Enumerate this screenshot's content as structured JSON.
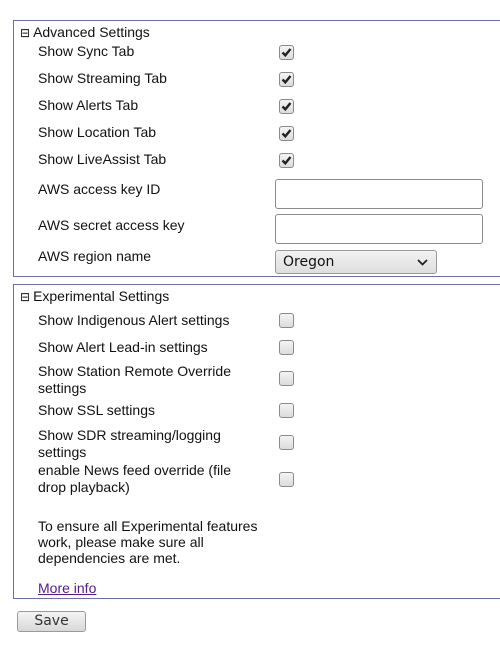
{
  "advanced": {
    "title": "Advanced Settings",
    "toggle_icon": "collapse-box-minus",
    "checkboxes": [
      {
        "label": "Show Sync Tab",
        "checked": true
      },
      {
        "label": "Show Streaming Tab",
        "checked": true
      },
      {
        "label": "Show Alerts Tab",
        "checked": true
      },
      {
        "label": "Show Location Tab",
        "checked": true
      },
      {
        "label": "Show LiveAssist Tab",
        "checked": true
      }
    ],
    "aws_access_key": {
      "label": "AWS access key ID",
      "value": ""
    },
    "aws_secret_key": {
      "label": "AWS secret access key",
      "value": ""
    },
    "aws_region": {
      "label": "AWS region name",
      "selected": "Oregon"
    }
  },
  "experimental": {
    "title": "Experimental Settings",
    "toggle_icon": "collapse-box-minus",
    "checkboxes": [
      {
        "label": "Show Indigenous Alert settings",
        "checked": false
      },
      {
        "label": "Show Alert Lead-in settings",
        "checked": false
      },
      {
        "label": "Show Station Remote Override settings",
        "checked": false
      },
      {
        "label": "Show SSL settings",
        "checked": false
      },
      {
        "label": "Show SDR streaming/logging settings",
        "checked": false
      },
      {
        "label": "enable News feed override (file drop playback)",
        "checked": false
      }
    ],
    "note": "To ensure all Experimental features work, please make sure all dependencies are met.",
    "more_info_link": "More info"
  },
  "save_label": "Save",
  "colors": {
    "border": "#6a6fa8",
    "link": "#551a8b"
  }
}
